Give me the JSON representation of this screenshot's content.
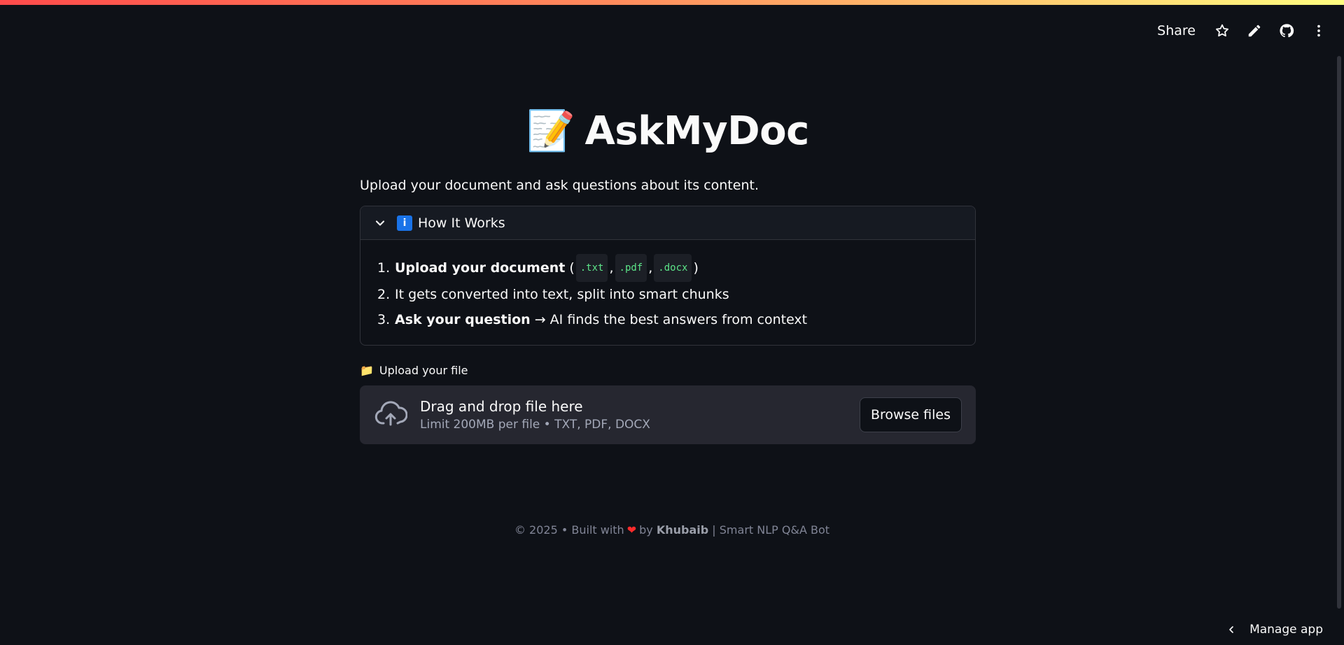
{
  "toolbar": {
    "share_label": "Share",
    "icons": [
      "star-icon",
      "pencil-icon",
      "github-icon",
      "more-vertical-icon"
    ]
  },
  "header": {
    "emoji": "📝",
    "title": "AskMyDoc",
    "subtitle": "Upload your document and ask questions about its content."
  },
  "expander": {
    "badge": "i",
    "label": "How It Works",
    "steps": {
      "s1": {
        "num": "1.",
        "bold": "Upload your document",
        "open": "(",
        "c1": ".txt",
        "sep1": ",",
        "c2": ".pdf",
        "sep2": ",",
        "c3": ".docx",
        "close": ")"
      },
      "s2": {
        "num": "2.",
        "text": "It gets converted into text, split into smart chunks"
      },
      "s3": {
        "num": "3.",
        "bold": "Ask your question",
        "text": "→ AI finds the best answers from context"
      }
    }
  },
  "uploader": {
    "label_emoji": "📁",
    "label": "Upload your file",
    "title": "Drag and drop file here",
    "subtitle": "Limit 200MB per file • TXT, PDF, DOCX",
    "browse_label": "Browse files"
  },
  "footer": {
    "prefix": "© 2025 • Built with",
    "heart": "❤",
    "by": "by",
    "author": "Khubaib",
    "suffix": "| Smart NLP Q&A Bot"
  },
  "manage_app": {
    "label": "Manage app"
  },
  "colors": {
    "background": "#0e1117",
    "accent_gradient": [
      "#ff4b4b",
      "#fffd80"
    ],
    "code_text": "#5ce488",
    "heart": "#ff2b2b",
    "info_badge": "#1a73e8"
  }
}
